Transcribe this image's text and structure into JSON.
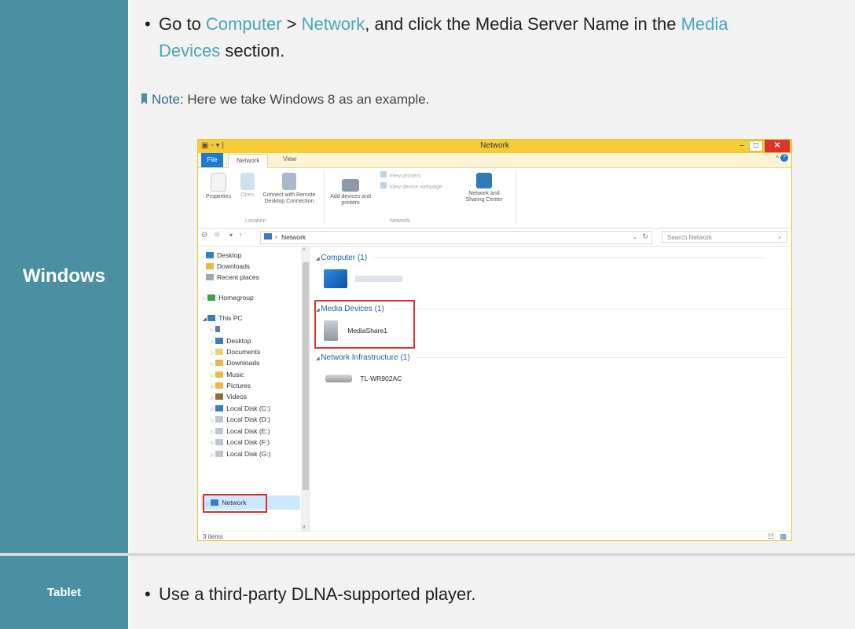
{
  "rows": [
    {
      "label": "Windows",
      "bullet": {
        "text_1": "Go to ",
        "link_computer": "Computer",
        "text_2": " > ",
        "link_network": "Network",
        "text_3": ", and click the Media Server Name in the ",
        "link_media_devices_1": "Media",
        "link_media_devices_2": "Devices",
        "text_4": " section."
      },
      "note": {
        "label": "Note",
        "text": ": Here we take Windows 8 as an example."
      }
    },
    {
      "label": "Tablet",
      "bullet": {
        "text": "Use a third-party DLNA-supported player."
      }
    }
  ],
  "explorer": {
    "window_title": "Network",
    "ribbon_tabs": [
      "File",
      "Network",
      "View"
    ],
    "ribbon_buttons": {
      "properties": "Properties",
      "open": "Open",
      "connect": "Connect with Remote Desktop Connection",
      "add_devices": "Add devices and printers",
      "view_printers": "View printers",
      "view_device_webpage": "View device webpage",
      "network_sharing": "Network and Sharing Center"
    },
    "ribbon_groups": {
      "location": "Location",
      "network": "Network"
    },
    "address": "Network",
    "search_placeholder": "Search Network",
    "nav_items": [
      "Desktop",
      "Downloads",
      "Recent places",
      "Homegroup",
      "This PC",
      "Desktop",
      "Documents",
      "Downloads",
      "Music",
      "Pictures",
      "Videos",
      "Local Disk (C:)",
      "Local Disk (D:)",
      "Local Disk (E:)",
      "Local Disk (F:)",
      "Local Disk (G:)",
      "Network"
    ],
    "groups": {
      "computer": "Computer (1)",
      "media_devices": "Media Devices (1)",
      "network_infrastructure": "Network Infrastructure (1)"
    },
    "items": {
      "media_server": "MediaShare1",
      "router": "TL-WR902AC"
    },
    "status": "3 items"
  },
  "colors": {
    "label_cell": "#4a8fa2",
    "link": "#4aa6b8",
    "highlight": "#d9352b",
    "title_bar": "#f5cc36"
  }
}
